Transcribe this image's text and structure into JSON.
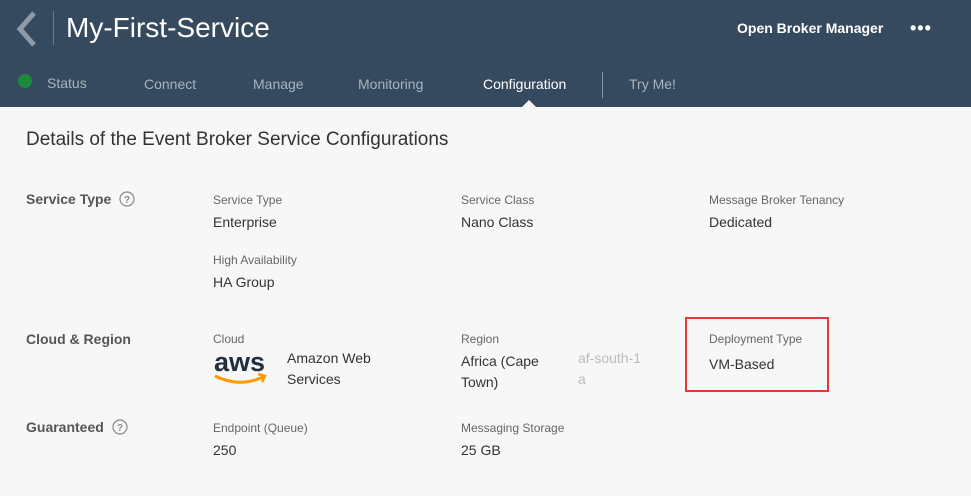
{
  "header": {
    "title": "My-First-Service",
    "open_broker_manager": "Open Broker Manager",
    "more": "•••"
  },
  "tabs": [
    {
      "label": "Status"
    },
    {
      "label": "Connect"
    },
    {
      "label": "Manage"
    },
    {
      "label": "Monitoring"
    },
    {
      "label": "Configuration",
      "active": true
    },
    {
      "label": "Try Me!"
    }
  ],
  "status_color": "#1e8a3c",
  "page_title": "Details of the Event Broker Service Configurations",
  "sections": {
    "service_type": {
      "title": "Service Type",
      "fields": [
        {
          "label": "Service Type",
          "value": "Enterprise"
        },
        {
          "label": "Service Class",
          "value": "Nano Class"
        },
        {
          "label": "Message Broker Tenancy",
          "value": "Dedicated"
        },
        {
          "label": "High Availability",
          "value": "HA Group"
        }
      ]
    },
    "cloud_region": {
      "title": "Cloud & Region",
      "cloud_label": "Cloud",
      "cloud_logo": "aws",
      "cloud_value": "Amazon Web Services",
      "region_label": "Region",
      "region_value": "Africa (Cape Town)",
      "region_code": "af-south-1a",
      "deployment_label": "Deployment Type",
      "deployment_value": "VM-Based"
    },
    "guaranteed": {
      "title": "Guaranteed",
      "fields": [
        {
          "label": "Endpoint (Queue)",
          "value": "250"
        },
        {
          "label": "Messaging Storage",
          "value": "25 GB"
        }
      ]
    }
  },
  "highlight_color": "#e5383b"
}
